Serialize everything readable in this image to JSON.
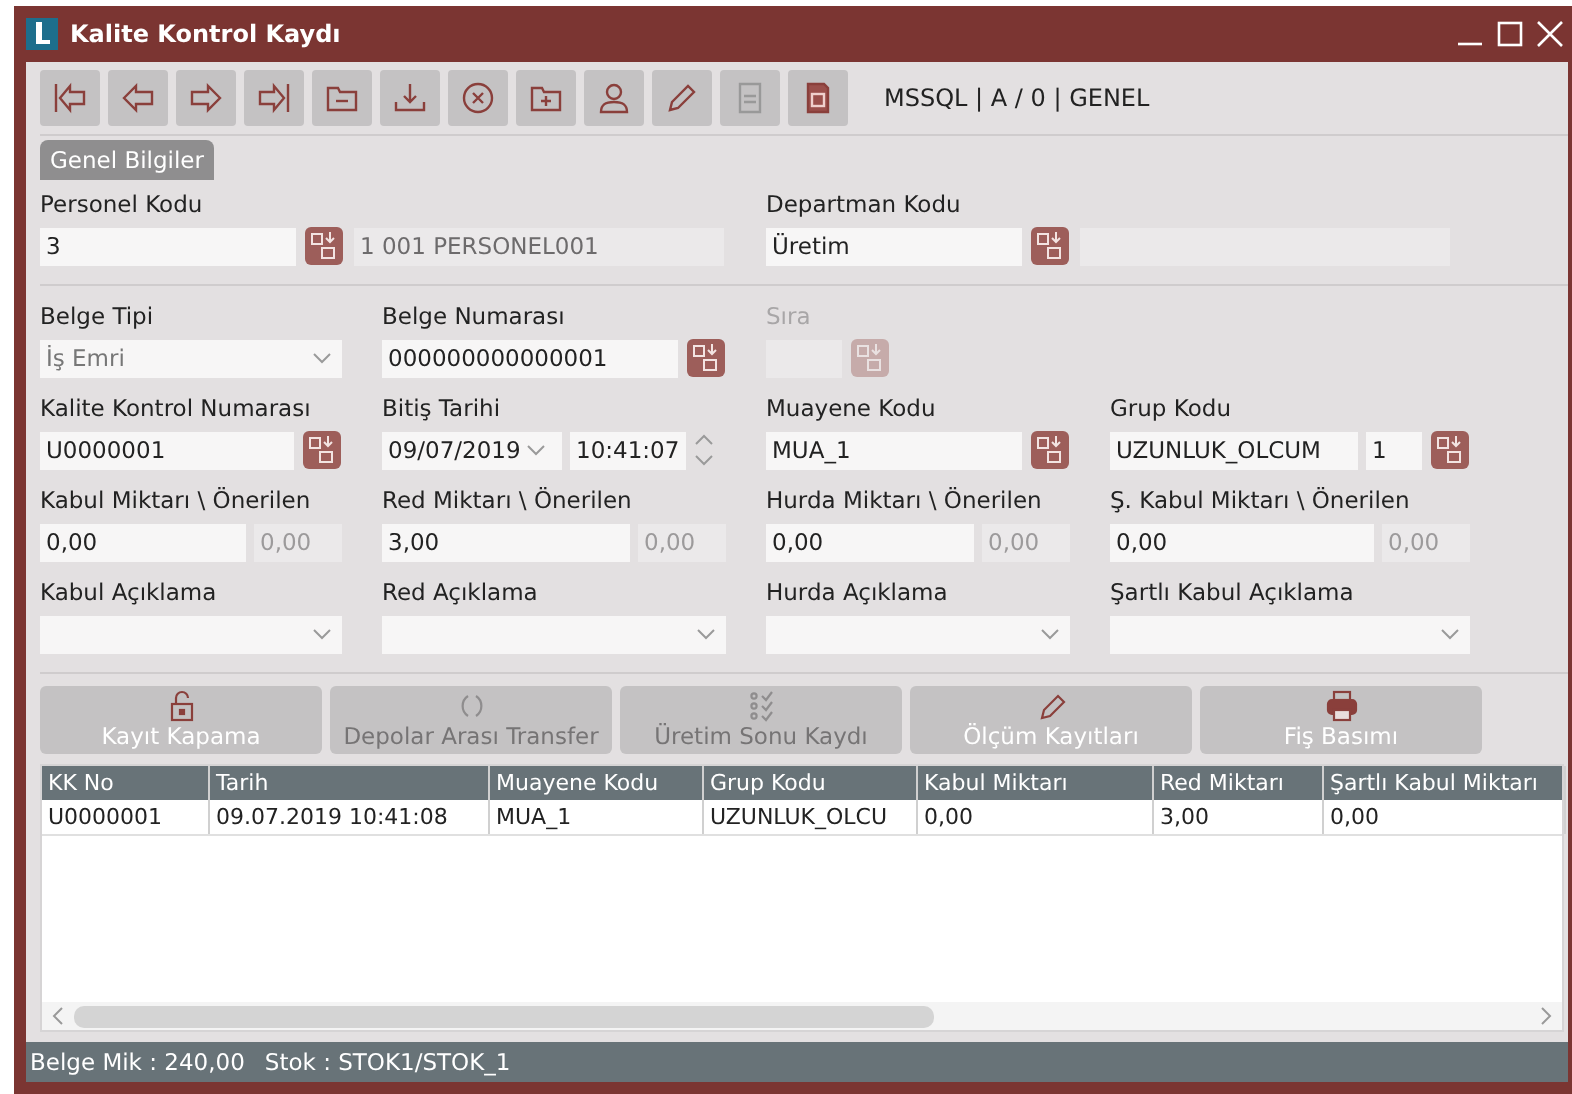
{
  "window": {
    "title": "Kalite Kontrol Kaydı"
  },
  "toolbar": {
    "connection": "MSSQL | A / 0 | GENEL"
  },
  "tabs": [
    {
      "label": "Genel Bilgiler",
      "selected": true
    }
  ],
  "top_fields": [
    {
      "label": "Personel Kodu",
      "value": "3",
      "description": "1 001 PERSONEL001",
      "disabled": false
    },
    {
      "label": "Departman Kodu",
      "value": "Üretim",
      "disabled": false
    }
  ],
  "fields": [
    {
      "kind": "combo",
      "label": "Belge Tipi",
      "value": "İş Emri",
      "disabled": false
    },
    {
      "kind": "lookup",
      "label": "Belge Numarası",
      "value": "000000000000001",
      "disabled": false
    },
    {
      "kind": "lookup",
      "label": "Sıra",
      "disabled": true
    },
    {
      "kind": "empty"
    },
    {
      "kind": "lookup",
      "label": "Kalite Kontrol Numarası",
      "value": "U0000001",
      "disabled": false
    },
    {
      "kind": "date",
      "label": "Bitiş Tarihi",
      "value": "09/07/2019",
      "time": "10:41:07",
      "disabled": false
    },
    {
      "kind": "lookup",
      "label": "Muayene Kodu",
      "value": "MUA_1",
      "disabled": false
    },
    {
      "kind": "lookup",
      "label": "Grup Kodu",
      "value": "UZUNLUK_OLCUM",
      "extra": "1",
      "disabled": false
    },
    {
      "kind": "qty",
      "label": "Kabul Miktarı \\ Önerilen",
      "value": "0,00",
      "suggested": "0,00",
      "disabled": false
    },
    {
      "kind": "qty",
      "label": "Red Miktarı \\ Önerilen",
      "value": "3,00",
      "suggested": "0,00",
      "disabled": false
    },
    {
      "kind": "qty",
      "label": "Hurda Miktarı \\ Önerilen",
      "value": "0,00",
      "suggested": "0,00",
      "disabled": false
    },
    {
      "kind": "qty",
      "label": "Ş. Kabul Miktarı \\ Önerilen",
      "value": "0,00",
      "suggested": "0,00",
      "disabled": false
    },
    {
      "kind": "combo",
      "label": "Kabul Açıklama",
      "disabled": false
    },
    {
      "kind": "combo",
      "label": "Red Açıklama",
      "disabled": false
    },
    {
      "kind": "combo",
      "label": "Hurda Açıklama",
      "disabled": false
    },
    {
      "kind": "combo",
      "label": "Şartlı Kabul Açıklama",
      "disabled": false
    }
  ],
  "actions": [
    {
      "kind": "lock",
      "label": "Kayıt Kapama",
      "disabled": false
    },
    {
      "kind": "transfer",
      "label": "Depolar Arası Transfer",
      "disabled": true
    },
    {
      "kind": "checklist",
      "label": "Üretim Sonu Kaydı",
      "disabled": true
    },
    {
      "kind": "pencil",
      "label": "Ölçüm Kayıtları",
      "disabled": false
    },
    {
      "kind": "printer",
      "label": "Fiş Basımı",
      "disabled": false
    }
  ],
  "table": {
    "columns": [
      "KK No",
      "Tarih",
      "Muayene Kodu",
      "Grup Kodu",
      "Kabul Miktarı",
      "Red Miktarı",
      "Şartlı Kabul Miktarı"
    ],
    "rows": [
      [
        "U0000001",
        "09.07.2019 10:41:08",
        "MUA_1",
        "UZUNLUK_OLCU",
        "0,00",
        "3,00",
        "0,00"
      ]
    ]
  },
  "status_bar": [
    "Belge Mik : 240,00",
    "Stok : STOK1/STOK_1"
  ]
}
